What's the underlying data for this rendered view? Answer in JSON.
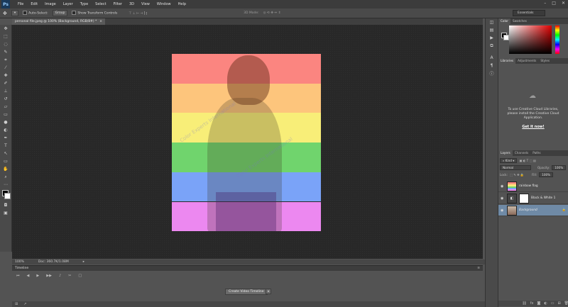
{
  "menubar": {
    "logo": "Ps",
    "items": [
      "File",
      "Edit",
      "Image",
      "Layer",
      "Type",
      "Select",
      "Filter",
      "3D",
      "View",
      "Window",
      "Help"
    ],
    "window_controls": [
      "–",
      "□",
      "✕"
    ]
  },
  "options": {
    "auto_select_label": "Auto-Select:",
    "auto_select_value": "Group",
    "transform_label": "Show Transform Controls",
    "mode_label": "3D Mode:",
    "workspace": "Essentials"
  },
  "document": {
    "tab_title": "personal file.jpeg @ 100% (Background, RGB/8#) *",
    "zoom": "100%",
    "doc_info": "Doc: 360.7K/1.08M"
  },
  "image": {
    "stripe_colors": [
      "#fb8580",
      "#fdc57c",
      "#f8ee78",
      "#70d46d",
      "#7aa3f8",
      "#ec88f0"
    ],
    "watermark": "Color Experts International"
  },
  "timeline": {
    "title": "Timeline",
    "create_button": "Create Video Timeline",
    "controls": [
      "⏮",
      "◀",
      "▶",
      "▶▶",
      "♪",
      "✂",
      "□"
    ]
  },
  "color_panel": {
    "tabs": [
      "Color",
      "Swatches"
    ],
    "accent": "#e00000"
  },
  "libraries_panel": {
    "tabs": [
      "Libraries",
      "Adjustments",
      "Styles"
    ],
    "message": "To use Creative Cloud Libraries, please install the Creative Cloud Application.",
    "link": "Get it now!"
  },
  "layers_panel": {
    "tabs": [
      "Layers",
      "Channels",
      "Paths"
    ],
    "filter_kind": "Kind",
    "blend_mode": "Normal",
    "opacity_label": "Opacity:",
    "opacity_value": "100%",
    "lock_label": "Lock:",
    "fill_label": "Fill:",
    "fill_value": "100%",
    "layers": [
      {
        "name": "rainbow flag",
        "selected": false
      },
      {
        "name": "Black & White 1",
        "selected": false
      },
      {
        "name": "Background",
        "selected": true
      }
    ]
  }
}
